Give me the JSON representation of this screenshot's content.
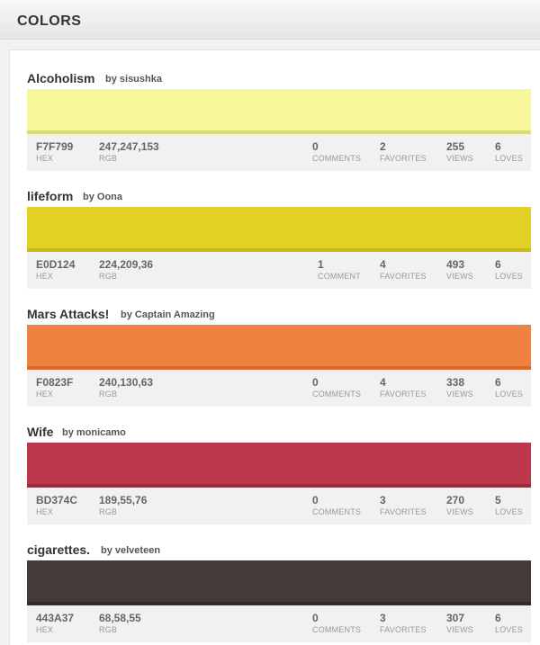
{
  "header": {
    "title": "COLORS"
  },
  "colors": [
    {
      "name": "Alcoholism",
      "by": "by sisushka",
      "hex": "F7F799",
      "rgb": "247,247,153",
      "comments": "0",
      "comments_label": "COMMENTS",
      "favorites": "2",
      "views": "255",
      "loves": "6",
      "swatch_color": "#F7F799",
      "swatch_edge": "#deda7c"
    },
    {
      "name": "lifeform",
      "by": "by Oona",
      "hex": "E0D124",
      "rgb": "224,209,36",
      "comments": "1",
      "comments_label": "COMMENT",
      "favorites": "4",
      "views": "493",
      "loves": "6",
      "swatch_color": "#E0D124",
      "swatch_edge": "#c8b91c"
    },
    {
      "name": "Mars Attacks!",
      "by": "by Captain Amazing",
      "hex": "F0823F",
      "rgb": "240,130,63",
      "comments": "0",
      "comments_label": "COMMENTS",
      "favorites": "4",
      "views": "338",
      "loves": "6",
      "swatch_color": "#F0823F",
      "swatch_edge": "#d46c2e"
    },
    {
      "name": "Wife",
      "by": "by monicamo",
      "hex": "BD374C",
      "rgb": "189,55,76",
      "comments": "0",
      "comments_label": "COMMENTS",
      "favorites": "3",
      "views": "270",
      "loves": "5",
      "swatch_color": "#BD374C",
      "swatch_edge": "#9e2b3d"
    },
    {
      "name": "cigarettes.",
      "by": "by velveteen",
      "hex": "443A37",
      "rgb": "68,58,55",
      "comments": "0",
      "comments_label": "COMMENTS",
      "favorites": "3",
      "views": "307",
      "loves": "6",
      "swatch_color": "#443A37",
      "swatch_edge": "#332b29"
    }
  ],
  "labels": {
    "hex": "HEX",
    "rgb": "RGB",
    "favorites": "FAVORITES",
    "views": "VIEWS",
    "loves": "LOVES"
  }
}
